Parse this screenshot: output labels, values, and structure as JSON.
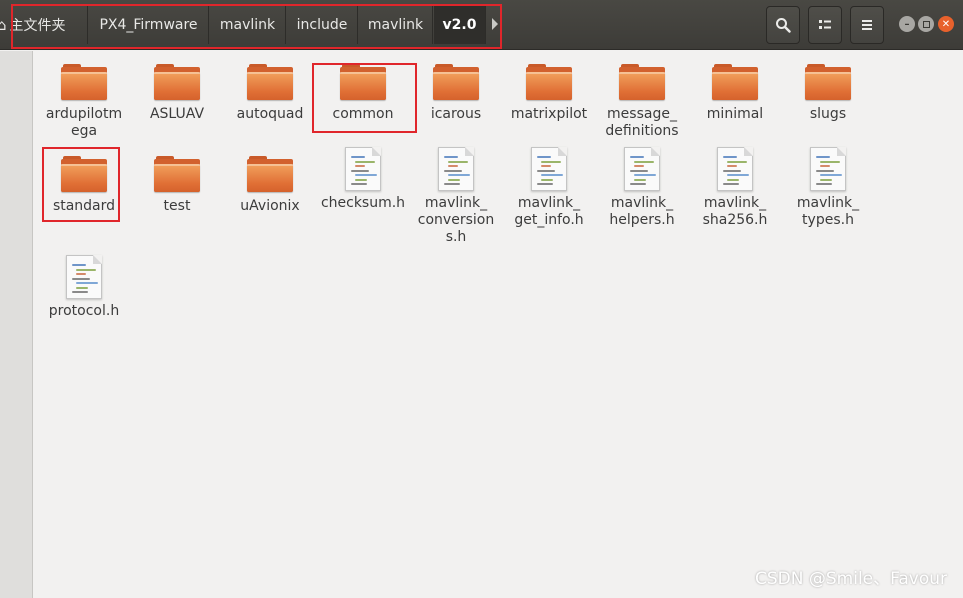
{
  "breadcrumbs": [
    {
      "label": "主文件夹",
      "active": false
    },
    {
      "label": "PX4_Firmware",
      "active": false
    },
    {
      "label": "mavlink",
      "active": false
    },
    {
      "label": "include",
      "active": false
    },
    {
      "label": "mavlink",
      "active": false
    },
    {
      "label": "v2.0",
      "active": true
    }
  ],
  "header_buttons": [
    {
      "icon": "search-icon"
    },
    {
      "icon": "view-toggle-icon"
    },
    {
      "icon": "menu-icon"
    }
  ],
  "window_controls": [
    {
      "icon": "minimize-icon",
      "color": "#a8a7a3"
    },
    {
      "icon": "maximize-icon",
      "color": "#a8a7a3"
    },
    {
      "icon": "close-icon",
      "color": "#e8612c"
    }
  ],
  "items": [
    {
      "type": "folder",
      "label": "ardupilotm\nega"
    },
    {
      "type": "folder",
      "label": "ASLUAV"
    },
    {
      "type": "folder",
      "label": "autoquad"
    },
    {
      "type": "folder",
      "label": "common"
    },
    {
      "type": "folder",
      "label": "icarous"
    },
    {
      "type": "folder",
      "label": "matrixpilot"
    },
    {
      "type": "folder",
      "label": "message_\ndefinitions"
    },
    {
      "type": "folder",
      "label": "minimal"
    },
    {
      "type": "folder",
      "label": "slugs"
    },
    {
      "type": "folder",
      "label": "standard"
    },
    {
      "type": "folder",
      "label": "test"
    },
    {
      "type": "folder",
      "label": "uAvionix"
    },
    {
      "type": "file",
      "label": "checksum.h"
    },
    {
      "type": "file",
      "label": "mavlink_\nconversion\ns.h"
    },
    {
      "type": "file",
      "label": "mavlink_\nget_info.h"
    },
    {
      "type": "file",
      "label": "mavlink_\nhelpers.h"
    },
    {
      "type": "file",
      "label": "mavlink_\nsha256.h"
    },
    {
      "type": "file",
      "label": "mavlink_\ntypes.h"
    },
    {
      "type": "file",
      "label": "protocol.h"
    }
  ],
  "colors": {
    "header_bg": "#3f3e3a",
    "annotation_red": "#e0262b",
    "folder_orange": "#e9793a",
    "content_bg": "#f2f1f0"
  },
  "watermark": "CSDN @Smile、Favour"
}
